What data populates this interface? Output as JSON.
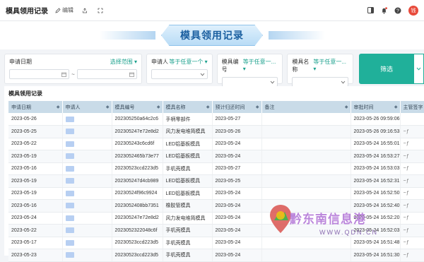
{
  "topbar": {
    "title": "模具领用记录",
    "edit_label": "编辑",
    "avatar_text": "钱"
  },
  "banner": {
    "title": "模具领用记录"
  },
  "filters": {
    "date": {
      "label": "申请日期",
      "range_label": "选择范围",
      "separator": "~"
    },
    "applicant": {
      "label": "申请人",
      "op": "等于任意一个"
    },
    "mold_no": {
      "label": "模具编号",
      "op": "等于任意一..."
    },
    "mold_name": {
      "label": "模具名称",
      "op": "等于任意一..."
    },
    "filter_button": "筛选"
  },
  "table": {
    "title": "模具领用记录",
    "columns": [
      "申请日期",
      "申请人",
      "模具编号",
      "模具名称",
      "预计归还时间",
      "备注",
      "审批时间",
      "主管签字"
    ],
    "rows": [
      [
        "2023-05-26",
        "",
        "202305250a64c2c6",
        "手柄零部件",
        "2023-05-27",
        "",
        "2023-05-26 09:59:06",
        ""
      ],
      [
        "2023-05-25",
        "",
        "2023052​47e72e8d2",
        "风力发电堆简模具",
        "2023-05-26",
        "",
        "2023-05-26 09:16:53",
        "sig"
      ],
      [
        "2023-05-22",
        "",
        "202305243c6cd6f",
        "LED铝基板模具",
        "2023-05-24",
        "",
        "2023-05-24 16:55:01",
        "sig"
      ],
      [
        "2023-05-19",
        "",
        "2023052465b73e77",
        "LED铝基板模具",
        "2023-05-24",
        "",
        "2023-05-24 16:53:27",
        "sig"
      ],
      [
        "2023-05-16",
        "",
        "202305​23ccd223d5",
        "手机壳模具",
        "2023-05-27",
        "",
        "2023-05-24 16:53:03",
        "sig"
      ],
      [
        "2023-05-19",
        "",
        "2023052​47d4cb989",
        "LED铝基板模具",
        "2023-05-25",
        "",
        "2023-05-24 16:52:31",
        "sig"
      ],
      [
        "2023-05-19",
        "",
        "202305​24f96c9924",
        "LED铝基板模具",
        "2023-05-24",
        "",
        "2023-05-24 16:52:50",
        "sig"
      ],
      [
        "2023-05-16",
        "",
        "202305​2408bb7351",
        "橡胶管模具",
        "2023-05-24",
        "",
        "2023-05-24 16:52:40",
        "sig"
      ],
      [
        "2023-05-24",
        "",
        "2023052​47e72e8d2",
        "风力发电堆简模具",
        "2023-05-24",
        "",
        "2023-05-24 16:52:20",
        "sig"
      ],
      [
        "2023-05-22",
        "",
        "20230523​22048c6f",
        "手机壳模具",
        "2023-05-24",
        "",
        "2023-05-24 16:52:03",
        "sig"
      ],
      [
        "2023-05-17",
        "",
        "202305​23ccd223d5",
        "手机壳模具",
        "2023-05-24",
        "",
        "2023-05-24 16:51:48",
        "sig"
      ],
      [
        "2023-05-23",
        "",
        "202305​23ccd223d5",
        "手机壳模具",
        "2023-05-24",
        "",
        "2023-05-24 16:51:30",
        "sig"
      ]
    ]
  },
  "watermark": {
    "text": "黔东南信息港",
    "url": "WWW.QDN.CN"
  }
}
